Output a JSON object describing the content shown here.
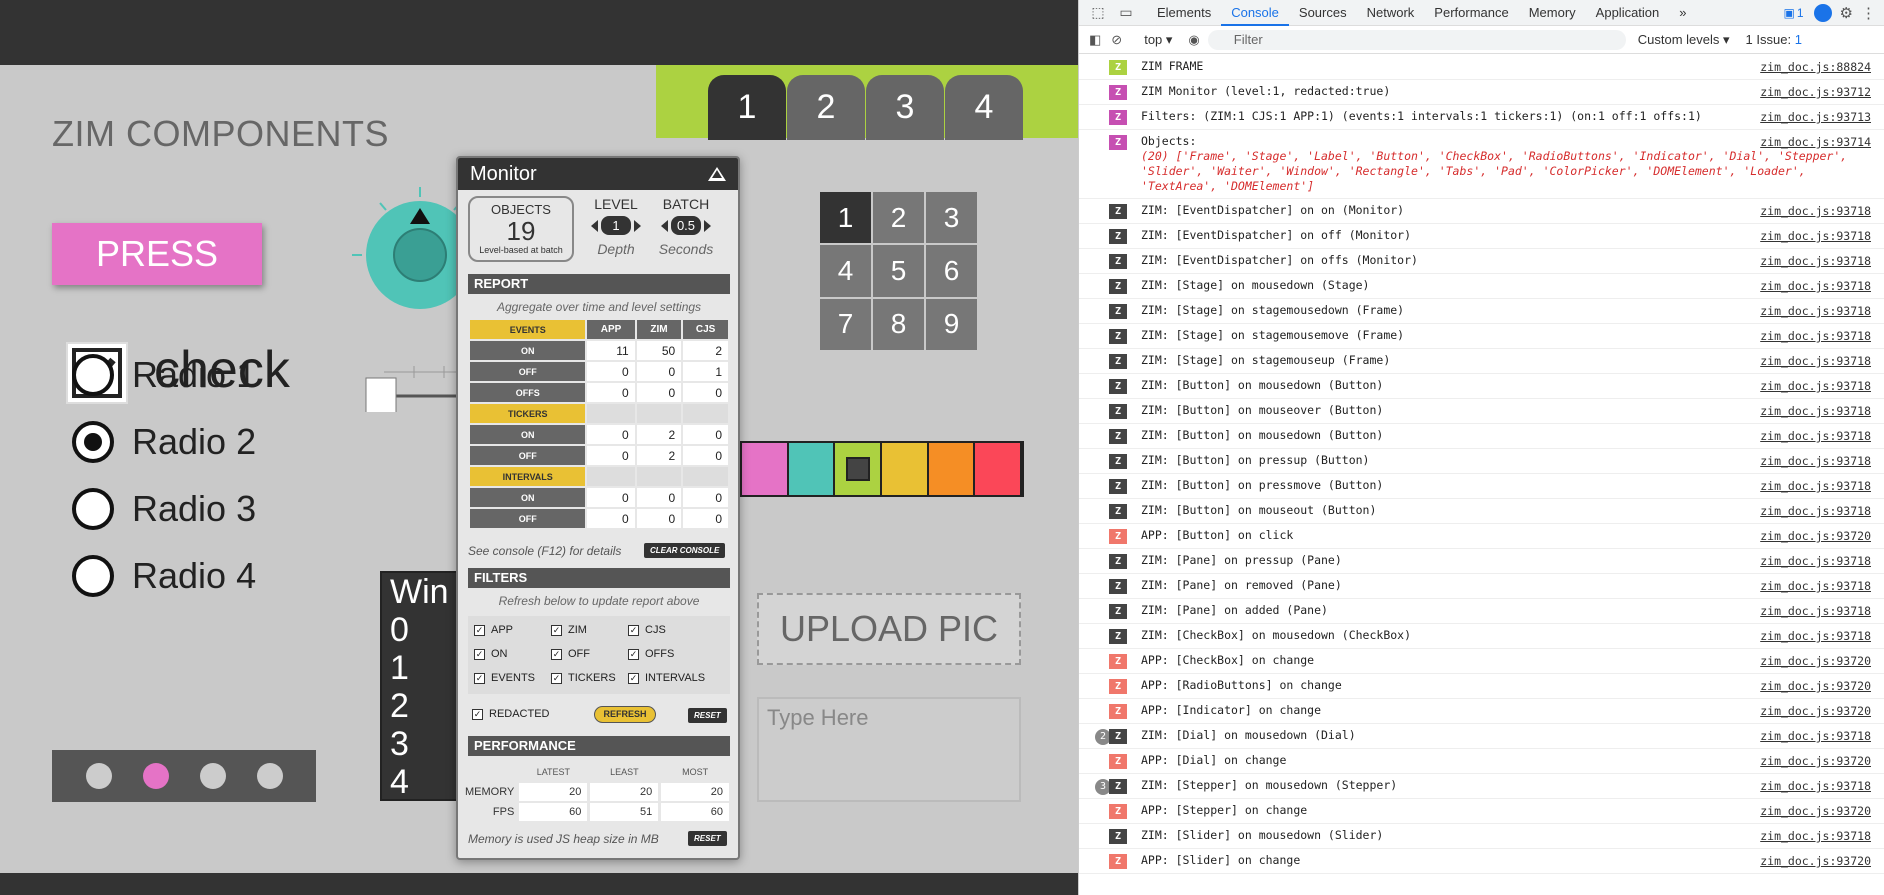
{
  "app": {
    "title": "ZIM COMPONENTS",
    "press_label": "PRESS",
    "check_label": "check",
    "radios": [
      "Radio 1",
      "Radio 2",
      "Radio 3",
      "Radio 4"
    ],
    "selected_radio": 1,
    "tabs": [
      "1",
      "2",
      "3",
      "4"
    ],
    "pad": [
      "1",
      "2",
      "3",
      "4",
      "5",
      "6",
      "7",
      "8",
      "9"
    ],
    "window_rows": [
      "Win",
      "0",
      "1",
      "2",
      "3",
      "4"
    ],
    "upload_label": "UPLOAD PIC",
    "textarea_placeholder": "Type Here",
    "indicator_selected": 1,
    "colors": {
      "press": "#e573c6",
      "dial": "#50c4b7",
      "tabs_bar": "#acd241"
    },
    "picker_colors": [
      "#e573c6",
      "#50c4b7",
      "#acd241",
      "#e9c134",
      "#f58e25",
      "#fb4758"
    ]
  },
  "monitor": {
    "title": "Monitor",
    "objects_label": "OBJECTS",
    "objects_value": "19",
    "objects_sub": "Level-based at batch",
    "level_label": "LEVEL",
    "level_value": "1",
    "level_sub": "Depth",
    "batch_label": "BATCH",
    "batch_value": "0.5",
    "batch_sub": "Seconds",
    "report_title": "REPORT",
    "report_note": "Aggregate over time and level settings",
    "col_events": "EVENTS",
    "col_app": "APP",
    "col_zim": "ZIM",
    "col_cjs": "CJS",
    "rows": {
      "ev_on": [
        "ON",
        "11",
        "50",
        "2"
      ],
      "ev_off": [
        "OFF",
        "0",
        "0",
        "1"
      ],
      "ev_offs": [
        "OFFS",
        "0",
        "0",
        "0"
      ],
      "tickers": "TICKERS",
      "tk_on": [
        "ON",
        "0",
        "2",
        "0"
      ],
      "tk_off": [
        "OFF",
        "0",
        "2",
        "0"
      ],
      "intervals": "INTERVALS",
      "iv_on": [
        "ON",
        "0",
        "0",
        "0"
      ],
      "iv_off": [
        "OFF",
        "0",
        "0",
        "0"
      ]
    },
    "console_note": "See console (F12) for details",
    "clear_console": "CLEAR CONSOLE",
    "filters_title": "FILTERS",
    "filters_note": "Refresh below to update report above",
    "filters": [
      "APP",
      "ZIM",
      "CJS",
      "ON",
      "OFF",
      "OFFS",
      "EVENTS",
      "TICKERS",
      "INTERVALS"
    ],
    "redacted": "REDACTED",
    "refresh": "REFRESH",
    "reset": "RESET",
    "perf_title": "PERFORMANCE",
    "perf_cols": [
      "LATEST",
      "LEAST",
      "MOST"
    ],
    "memory": [
      "MEMORY",
      "20",
      "20",
      "20"
    ],
    "fps": [
      "FPS",
      "60",
      "51",
      "60"
    ],
    "perf_note": "Memory is used JS heap size in MB"
  },
  "devtools": {
    "tabs": [
      "Elements",
      "Console",
      "Sources",
      "Network",
      "Performance",
      "Memory",
      "Application"
    ],
    "active_tab": "Console",
    "more": "»",
    "msg_badge": "1",
    "context": "top",
    "filter_placeholder": "Filter",
    "levels": "Custom levels",
    "issues": "1 Issue:",
    "issue_count": "1",
    "log": [
      {
        "badge": "Z",
        "color": "#acd241",
        "text": "ZIM FRAME",
        "src": "zim_doc.js:88824"
      },
      {
        "badge": "Z",
        "color": "#c64fb2",
        "text": "ZIM Monitor (level:1, redacted:true)",
        "src": "zim_doc.js:93712"
      },
      {
        "badge": "Z",
        "color": "#c64fb2",
        "text": "Filters: (ZIM:1 CJS:1 APP:1) (events:1 intervals:1 tickers:1) (on:1 off:1 offs:1)",
        "src": "zim_doc.js:93713"
      },
      {
        "badge": "Z",
        "color": "#c64fb2",
        "text": "Objects:",
        "src": "zim_doc.js:93714",
        "extra": "(20) ['Frame', 'Stage', 'Label', 'Button', 'CheckBox', 'RadioButtons', 'Indicator', 'Dial', 'Stepper', 'Slider', 'Waiter', 'Window', 'Rectangle', 'Tabs', 'Pad', 'ColorPicker', 'DOMElement', 'Loader', 'TextArea', 'DOMElement']"
      },
      {
        "badge": "Z",
        "color": "#444",
        "text": "ZIM: [EventDispatcher] on on (Monitor)",
        "src": "zim_doc.js:93718"
      },
      {
        "badge": "Z",
        "color": "#444",
        "text": "ZIM: [EventDispatcher] on off (Monitor)",
        "src": "zim_doc.js:93718"
      },
      {
        "badge": "Z",
        "color": "#444",
        "text": "ZIM: [EventDispatcher] on offs (Monitor)",
        "src": "zim_doc.js:93718"
      },
      {
        "badge": "Z",
        "color": "#444",
        "text": "ZIM: [Stage] on mousedown (Stage)",
        "src": "zim_doc.js:93718"
      },
      {
        "badge": "Z",
        "color": "#444",
        "text": "ZIM: [Stage] on stagemousedown (Frame)",
        "src": "zim_doc.js:93718"
      },
      {
        "badge": "Z",
        "color": "#444",
        "text": "ZIM: [Stage] on stagemousemove (Frame)",
        "src": "zim_doc.js:93718"
      },
      {
        "badge": "Z",
        "color": "#444",
        "text": "ZIM: [Stage] on stagemouseup (Frame)",
        "src": "zim_doc.js:93718"
      },
      {
        "badge": "Z",
        "color": "#444",
        "text": "ZIM: [Button] on mousedown (Button)",
        "src": "zim_doc.js:93718"
      },
      {
        "badge": "Z",
        "color": "#444",
        "text": "ZIM: [Button] on mouseover (Button)",
        "src": "zim_doc.js:93718"
      },
      {
        "badge": "Z",
        "color": "#444",
        "text": "ZIM: [Button] on mousedown (Button)",
        "src": "zim_doc.js:93718"
      },
      {
        "badge": "Z",
        "color": "#444",
        "text": "ZIM: [Button] on pressup (Button)",
        "src": "zim_doc.js:93718"
      },
      {
        "badge": "Z",
        "color": "#444",
        "text": "ZIM: [Button] on pressmove (Button)",
        "src": "zim_doc.js:93718"
      },
      {
        "badge": "Z",
        "color": "#444",
        "text": "ZIM: [Button] on mouseout (Button)",
        "src": "zim_doc.js:93718"
      },
      {
        "badge": "Z",
        "color": "#f0776b",
        "text": "APP: [Button] on click",
        "src": "zim_doc.js:93720"
      },
      {
        "badge": "Z",
        "color": "#444",
        "text": "ZIM: [Pane] on pressup (Pane)",
        "src": "zim_doc.js:93718"
      },
      {
        "badge": "Z",
        "color": "#444",
        "text": "ZIM: [Pane] on removed (Pane)",
        "src": "zim_doc.js:93718"
      },
      {
        "badge": "Z",
        "color": "#444",
        "text": "ZIM: [Pane] on added (Pane)",
        "src": "zim_doc.js:93718"
      },
      {
        "badge": "Z",
        "color": "#444",
        "text": "ZIM: [CheckBox] on mousedown (CheckBox)",
        "src": "zim_doc.js:93718"
      },
      {
        "badge": "Z",
        "color": "#f0776b",
        "text": "APP: [CheckBox] on change",
        "src": "zim_doc.js:93720"
      },
      {
        "badge": "Z",
        "color": "#f0776b",
        "text": "APP: [RadioButtons] on change",
        "src": "zim_doc.js:93720"
      },
      {
        "badge": "Z",
        "color": "#f0776b",
        "text": "APP: [Indicator] on change",
        "src": "zim_doc.js:93720"
      },
      {
        "badge": "Z",
        "color": "#444",
        "text": "ZIM: [Dial] on mousedown (Dial)",
        "src": "zim_doc.js:93718",
        "count": "2"
      },
      {
        "badge": "Z",
        "color": "#f0776b",
        "text": "APP: [Dial] on change",
        "src": "zim_doc.js:93720"
      },
      {
        "badge": "Z",
        "color": "#444",
        "text": "ZIM: [Stepper] on mousedown (Stepper)",
        "src": "zim_doc.js:93718",
        "count": "3"
      },
      {
        "badge": "Z",
        "color": "#f0776b",
        "text": "APP: [Stepper] on change",
        "src": "zim_doc.js:93720"
      },
      {
        "badge": "Z",
        "color": "#444",
        "text": "ZIM: [Slider] on mousedown (Slider)",
        "src": "zim_doc.js:93718"
      },
      {
        "badge": "Z",
        "color": "#f0776b",
        "text": "APP: [Slider] on change",
        "src": "zim_doc.js:93720"
      }
    ]
  }
}
